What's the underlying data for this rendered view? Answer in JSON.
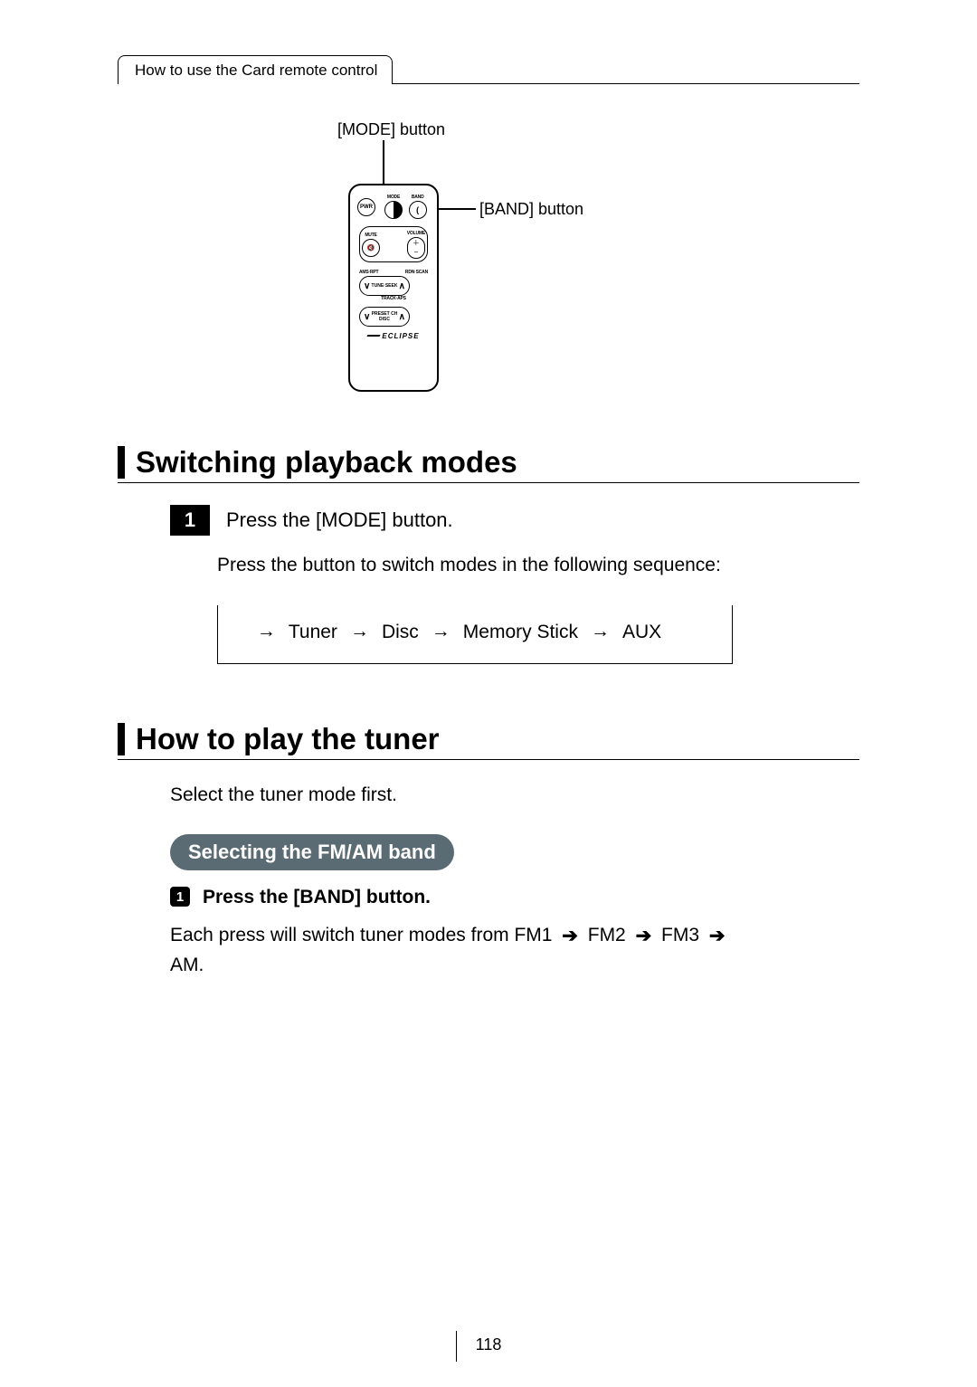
{
  "header": {
    "breadcrumb": "How to use the Card remote control"
  },
  "diagram": {
    "mode_callout": "[MODE] button",
    "band_callout": "[BAND] button",
    "remote": {
      "pwr": "PWR",
      "mode": "MODE",
      "band": "BAND",
      "mute": "MUTE",
      "volume": "VOLUME",
      "tune_seek": "TUNE·SEEK",
      "track_aps": "TRACK·APS",
      "preset_disc": "PRESET CH\nDISC",
      "brand": "ECLIPSE"
    }
  },
  "section1": {
    "title": "Switching playback modes",
    "step1_num": "1",
    "step1_text": "Press the [MODE] button.",
    "body": "Press the button to switch modes in the following sequence:",
    "flow": {
      "item1": "Tuner",
      "item2": "Disc",
      "item3": "Memory Stick",
      "item4": "AUX"
    }
  },
  "section2": {
    "title": "How to play the tuner",
    "intro": "Select the tuner mode first.",
    "pill": "Selecting the FM/AM band",
    "substep_num": "1",
    "substep_text": "Press the [BAND] button.",
    "note_pre": "Each press will switch tuner modes from FM1 ",
    "arrow": "➔",
    "note_fm2": " FM2 ",
    "note_fm3": " FM3 ",
    "note_am": " AM."
  },
  "page_number": "118"
}
